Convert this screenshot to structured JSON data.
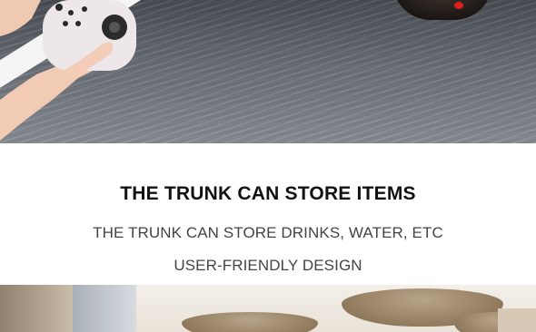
{
  "hero": {
    "image_label": "Remote control and road",
    "icons": [
      "remote-control-icon",
      "car-wheel-icon"
    ]
  },
  "section": {
    "title": "THE TRUNK CAN STORE ITEMS",
    "line1": "THE TRUNK CAN STORE DRINKS, WATER, ETC",
    "line2": "USER-FRIENDLY DESIGN"
  },
  "bottom": {
    "image_label": "Fountain scene"
  },
  "colors": {
    "title": "#121212",
    "subtitle": "#444444",
    "background": "#ffffff"
  }
}
